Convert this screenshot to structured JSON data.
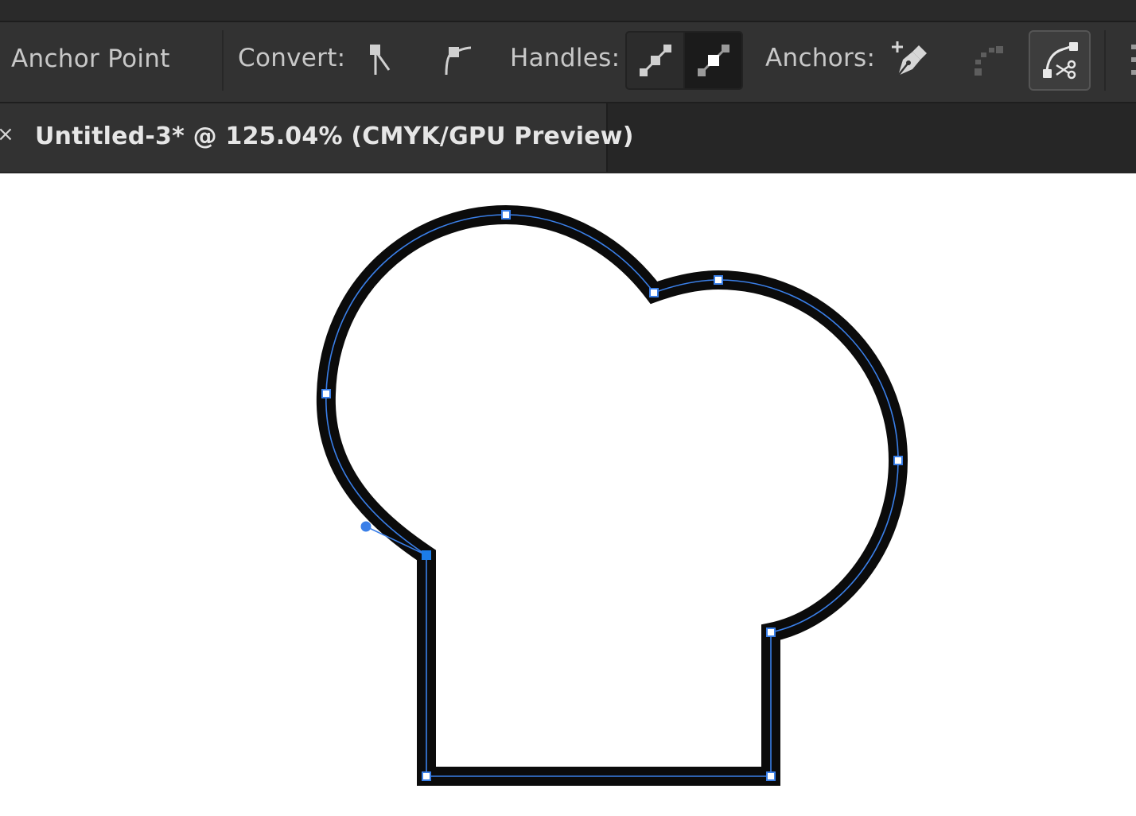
{
  "app": {
    "tool_name": "Anchor Point"
  },
  "control_bar": {
    "convert_label": "Convert:",
    "convert_buttons": [
      {
        "icon": "convert-to-corner-icon",
        "state": "normal"
      },
      {
        "icon": "convert-to-smooth-icon",
        "state": "normal"
      }
    ],
    "handles_label": "Handles:",
    "handles_buttons": [
      {
        "icon": "show-handles-icon",
        "state": "normal"
      },
      {
        "icon": "hide-handles-icon",
        "state": "active"
      }
    ],
    "anchors_label": "Anchors:",
    "anchors_buttons": [
      {
        "icon": "pen-add-anchor-icon",
        "state": "normal"
      },
      {
        "icon": "connect-anchors-icon",
        "state": "disabled"
      },
      {
        "icon": "cut-path-at-anchor-icon",
        "state": "highlighted"
      }
    ]
  },
  "document_tab": {
    "close_glyph": "×",
    "title": "Untitled-3* @ 125.04% (CMYK/GPU Preview)"
  },
  "canvas": {
    "background": "#ffffff",
    "stroke_color": "#0b0b0b",
    "path_highlight_color": "#3a7fe8",
    "selected_anchor_color": "#1b7ce8"
  },
  "colors": {
    "control_bar_bg": "#323232",
    "tab_bar_bg": "#262626",
    "label_text": "#c8c8c8"
  }
}
